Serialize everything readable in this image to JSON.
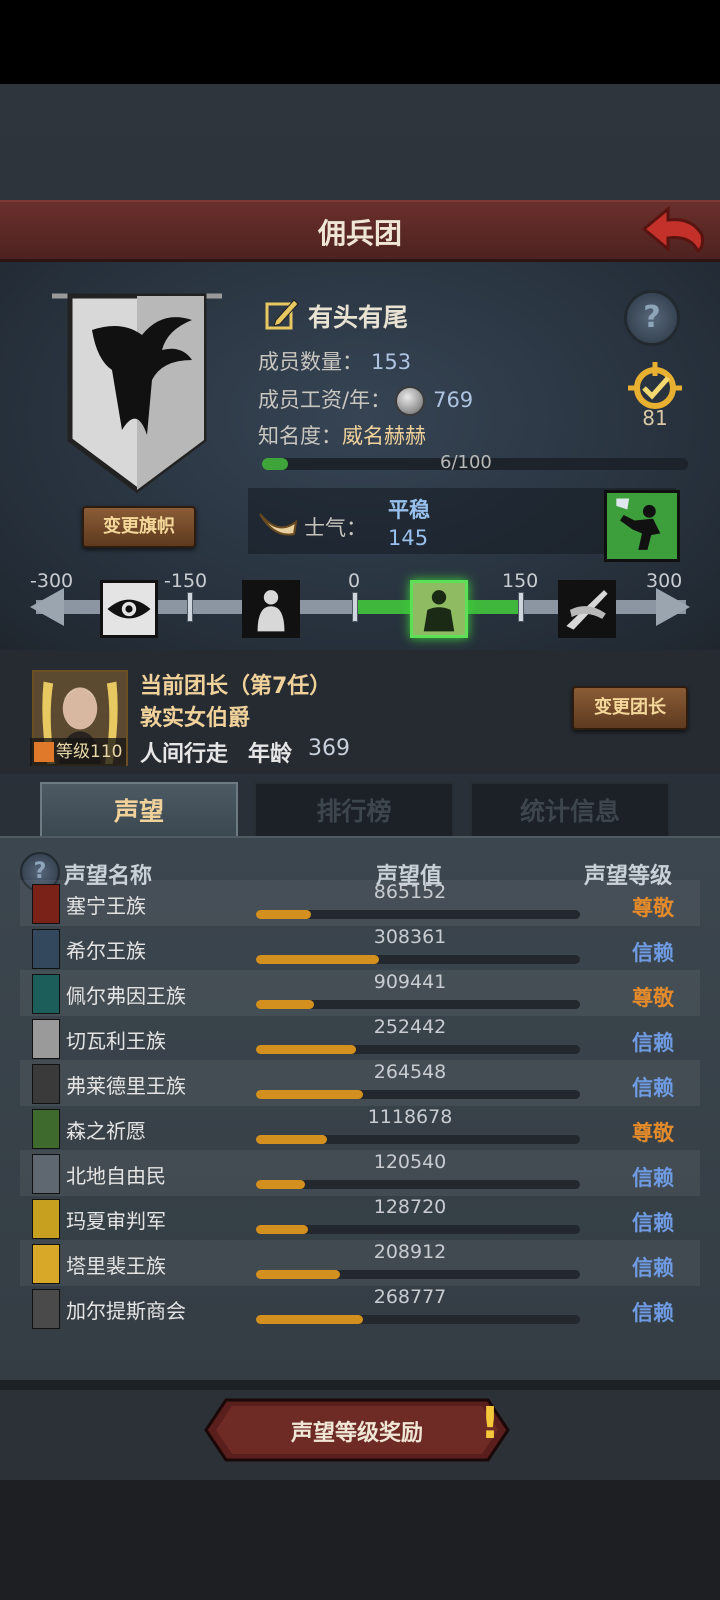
{
  "header": {
    "title": "佣兵团"
  },
  "guild": {
    "name": "有头有尾",
    "members_label": "成员数量：",
    "members": "153",
    "salary_label": "成员工资/年：",
    "salary": "769",
    "fame_label": "知名度：",
    "fame_title": "威名赫赫",
    "fame_progress": "6/100",
    "fame_fraction": 0.06,
    "rank": "81",
    "change_flag": "变更旗帜"
  },
  "morale": {
    "label": "士气：",
    "state": "平稳",
    "value": "145",
    "scale_labels": [
      "-300",
      "-150",
      "0",
      "150",
      "300"
    ],
    "active_stage": "stable"
  },
  "leader": {
    "title": "当前团长（第7任）",
    "rank": "敦实女伯爵",
    "level": "等级110",
    "trait": "人间行走",
    "age_label": "年龄",
    "age": "369",
    "change_button": "变更团长"
  },
  "tabs": [
    {
      "label": "声望",
      "active": true
    },
    {
      "label": "排行榜",
      "active": false
    },
    {
      "label": "统计信息",
      "active": false
    }
  ],
  "table": {
    "headers": [
      "声望名称",
      "声望值",
      "声望等级"
    ],
    "rows": [
      {
        "name": "塞宁王族",
        "value": "865152",
        "level": "尊敬",
        "fill": 0.17,
        "color": "#7a2218"
      },
      {
        "name": "希尔王族",
        "value": "308361",
        "level": "信赖",
        "fill": 0.38,
        "color": "#33485c"
      },
      {
        "name": "佩尔弗因王族",
        "value": "909441",
        "level": "尊敬",
        "fill": 0.18,
        "color": "#1c5f5a"
      },
      {
        "name": "切瓦利王族",
        "value": "252442",
        "level": "信赖",
        "fill": 0.31,
        "color": "#9a9a9a"
      },
      {
        "name": "弗莱德里王族",
        "value": "264548",
        "level": "信赖",
        "fill": 0.33,
        "color": "#3a3a3a"
      },
      {
        "name": "森之祈愿",
        "value": "1118678",
        "level": "尊敬",
        "fill": 0.22,
        "color": "#3f6a2e"
      },
      {
        "name": "北地自由民",
        "value": "120540",
        "level": "信赖",
        "fill": 0.15,
        "color": "#5f6870"
      },
      {
        "name": "玛夏审判军",
        "value": "128720",
        "level": "信赖",
        "fill": 0.16,
        "color": "#c8a020"
      },
      {
        "name": "塔里裴王族",
        "value": "208912",
        "level": "信赖",
        "fill": 0.26,
        "color": "#d8a828"
      },
      {
        "name": "加尔提斯商会",
        "value": "268777",
        "level": "信赖",
        "fill": 0.33,
        "color": "#4a4a4a"
      }
    ]
  },
  "reward_button": "声望等级奖励"
}
